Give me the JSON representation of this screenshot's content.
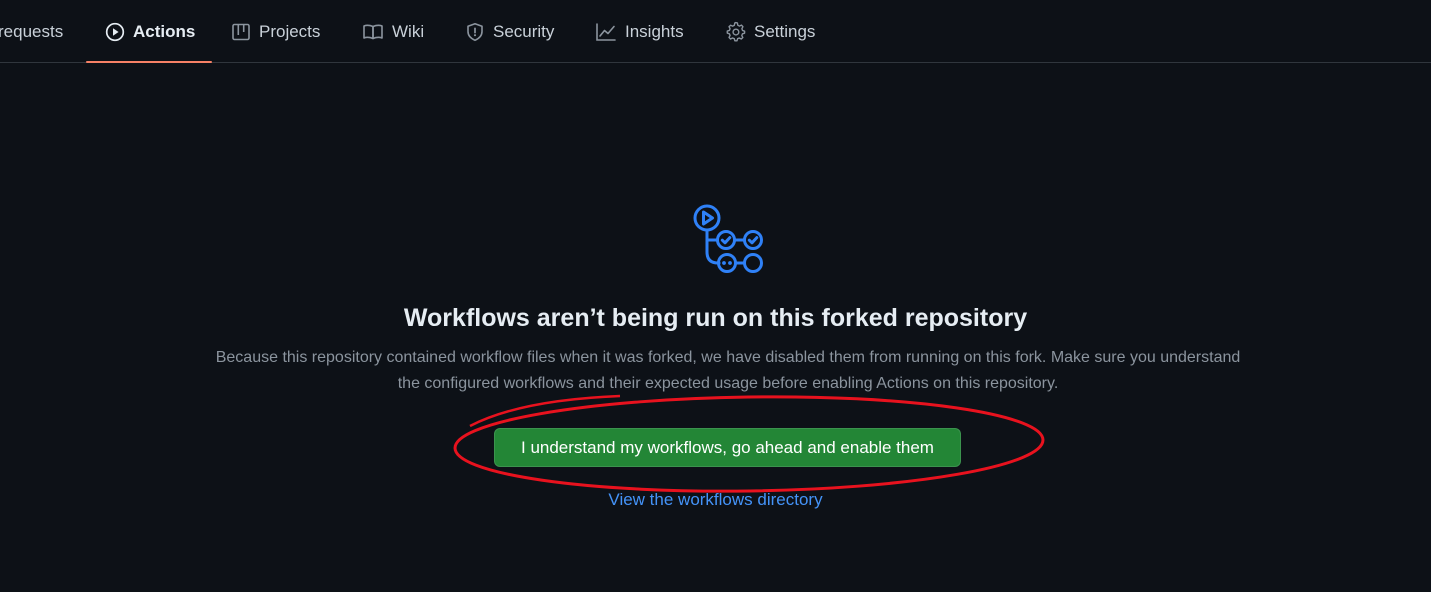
{
  "nav": {
    "tabs": [
      {
        "label": "requests",
        "icon": "pull-request-icon",
        "active": false
      },
      {
        "label": "Actions",
        "icon": "play-icon",
        "active": true
      },
      {
        "label": "Projects",
        "icon": "table-icon",
        "active": false
      },
      {
        "label": "Wiki",
        "icon": "book-icon",
        "active": false
      },
      {
        "label": "Security",
        "icon": "shield-icon",
        "active": false
      },
      {
        "label": "Insights",
        "icon": "graph-icon",
        "active": false
      },
      {
        "label": "Settings",
        "icon": "gear-icon",
        "active": false
      }
    ],
    "active_underline_color": "#f78166"
  },
  "main": {
    "icon": "workflow-icon",
    "icon_color": "#2f81f7",
    "title": "Workflows aren’t being run on this forked repository",
    "description": "Because this repository contained workflow files when it was forked, we have disabled them from running on this fork. Make sure you understand the configured workflows and their expected usage before enabling Actions on this repository.",
    "enable_button_label": "I understand my workflows, go ahead and enable them",
    "enable_button_color": "#238636",
    "workflows_link_label": "View the workflows directory",
    "link_color": "#4493f8",
    "annotation_color": "#e8121e"
  }
}
